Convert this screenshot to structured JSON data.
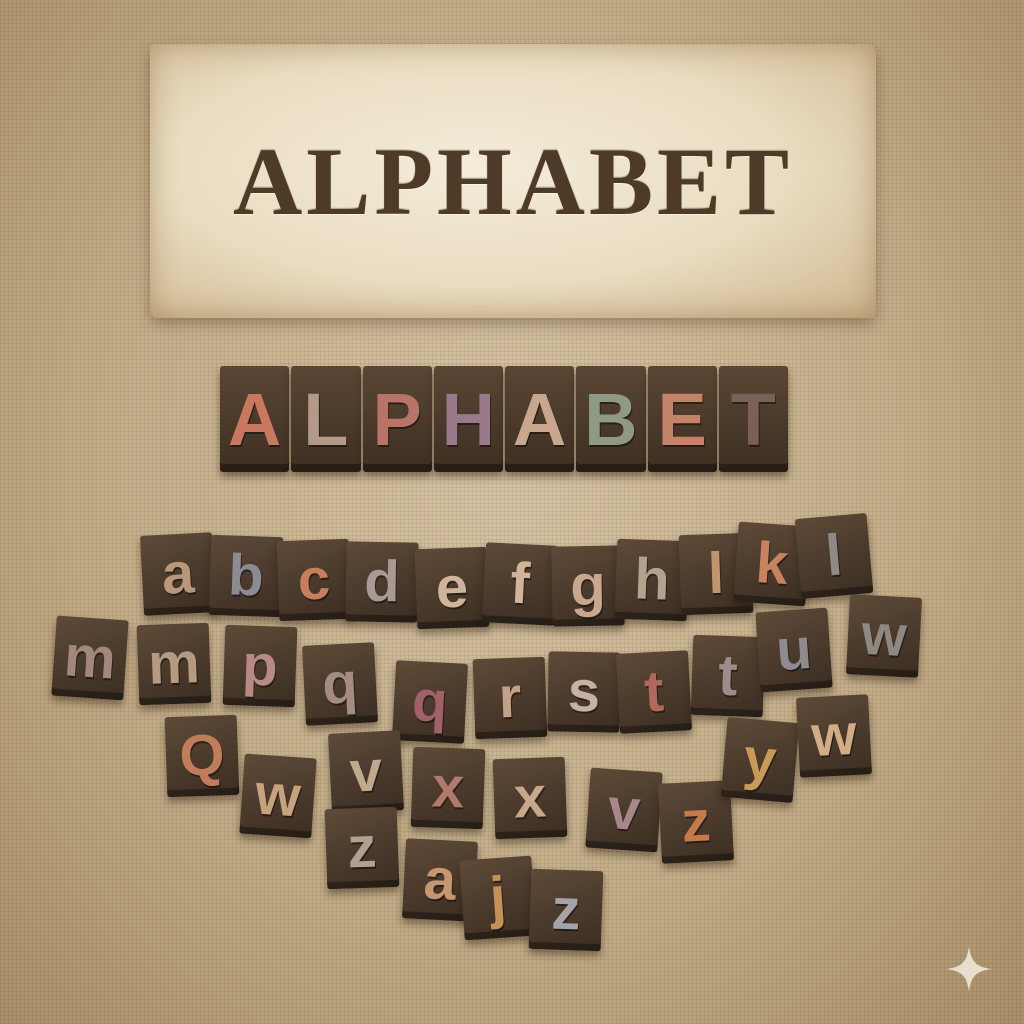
{
  "card": {
    "title": "ALPHABET"
  },
  "blocks": {
    "letters": [
      "A",
      "L",
      "P",
      "H",
      "A",
      "B",
      "E",
      "T"
    ],
    "colors": [
      "#c97860",
      "#b39a86",
      "#b97468",
      "#9a7a8a",
      "#c9a68e",
      "#8f9a84",
      "#c48268",
      "#7a6058"
    ]
  },
  "tiles": [
    {
      "letter": "a",
      "color": "#b9977a"
    },
    {
      "letter": "b",
      "color": "#8c8a92"
    },
    {
      "letter": "c",
      "color": "#c57f5c"
    },
    {
      "letter": "d",
      "color": "#a69a92"
    },
    {
      "letter": "e",
      "color": "#cfb39a"
    },
    {
      "letter": "f",
      "color": "#d2b49a"
    },
    {
      "letter": "g",
      "color": "#c9a68c"
    },
    {
      "letter": "h",
      "color": "#b2a28e"
    },
    {
      "letter": "l",
      "color": "#c2946e"
    },
    {
      "letter": "k",
      "color": "#c8825e"
    },
    {
      "letter": "l",
      "color": "#8f8a86"
    },
    {
      "letter": "m",
      "color": "#a4877c"
    },
    {
      "letter": "m",
      "color": "#b49a80"
    },
    {
      "letter": "p",
      "color": "#b88a86"
    },
    {
      "letter": "q",
      "color": "#a58b82"
    },
    {
      "letter": "q",
      "color": "#a2606a"
    },
    {
      "letter": "r",
      "color": "#c3a186"
    },
    {
      "letter": "s",
      "color": "#c9b0a4"
    },
    {
      "letter": "t",
      "color": "#b06a5c"
    },
    {
      "letter": "t",
      "color": "#9c8c8c"
    },
    {
      "letter": "u",
      "color": "#8e8a8e"
    },
    {
      "letter": "w",
      "color": "#8e8880"
    },
    {
      "letter": "Q",
      "color": "#bf7d5c"
    },
    {
      "letter": "w",
      "color": "#c6a27e"
    },
    {
      "letter": "v",
      "color": "#c1a98e"
    },
    {
      "letter": "x",
      "color": "#b07a6c"
    },
    {
      "letter": "x",
      "color": "#c8a88a"
    },
    {
      "letter": "v",
      "color": "#a6888a"
    },
    {
      "letter": "z",
      "color": "#c47a4a"
    },
    {
      "letter": "y",
      "color": "#c89a58"
    },
    {
      "letter": "w",
      "color": "#d0ad86"
    },
    {
      "letter": "z",
      "color": "#b0a090"
    },
    {
      "letter": "a",
      "color": "#c69670"
    },
    {
      "letter": "j",
      "color": "#c69058"
    },
    {
      "letter": "z",
      "color": "#a4a4a8"
    }
  ],
  "sparkle": {
    "icon": "sparkle-icon",
    "color": "#f2ecdf"
  }
}
